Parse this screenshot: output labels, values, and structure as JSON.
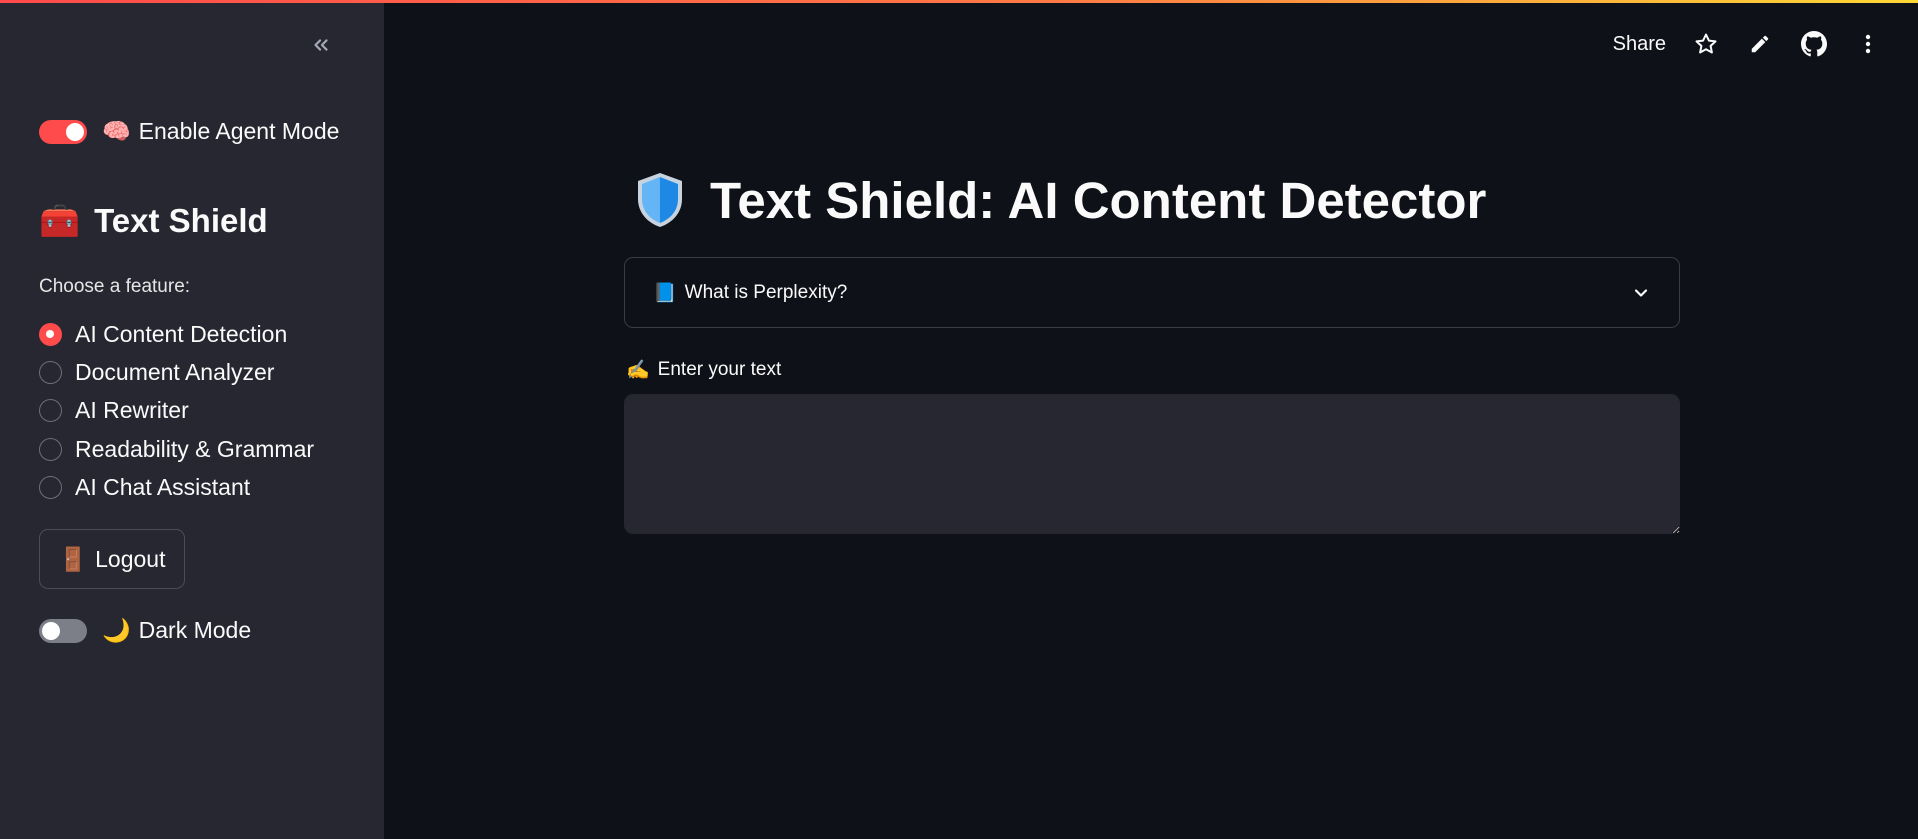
{
  "colors": {
    "accent": "#ff4b4b",
    "sidebar_bg": "#262730",
    "main_bg": "#0e1117",
    "text": "#fafafa"
  },
  "sidebar": {
    "collapse_icon": "double-chevron-left-icon",
    "agent_mode": {
      "emoji": "🧠",
      "label": "Enable Agent Mode",
      "checked": true
    },
    "title_emoji": "🧰",
    "title": "Text Shield",
    "feature_prompt": "Choose a feature:",
    "features": [
      {
        "label": "AI Content Detection",
        "selected": true
      },
      {
        "label": "Document Analyzer",
        "selected": false
      },
      {
        "label": "AI Rewriter",
        "selected": false
      },
      {
        "label": "Readability & Grammar",
        "selected": false
      },
      {
        "label": "AI Chat Assistant",
        "selected": false
      }
    ],
    "logout": {
      "emoji": "🚪",
      "label": "Logout"
    },
    "dark_mode": {
      "emoji": "🌙",
      "label": "Dark Mode",
      "checked": false
    }
  },
  "header": {
    "share_label": "Share",
    "icons": [
      "star-icon",
      "pencil-icon",
      "github-icon",
      "more-vertical-icon"
    ]
  },
  "main": {
    "title_emoji": "🛡️",
    "title": "Text Shield: AI Content Detector",
    "expander": {
      "emoji": "📘",
      "label": "What is Perplexity?",
      "icon": "chevron-down-icon"
    },
    "input": {
      "emoji": "✍️",
      "label": "Enter your text",
      "value": "",
      "placeholder": ""
    }
  }
}
